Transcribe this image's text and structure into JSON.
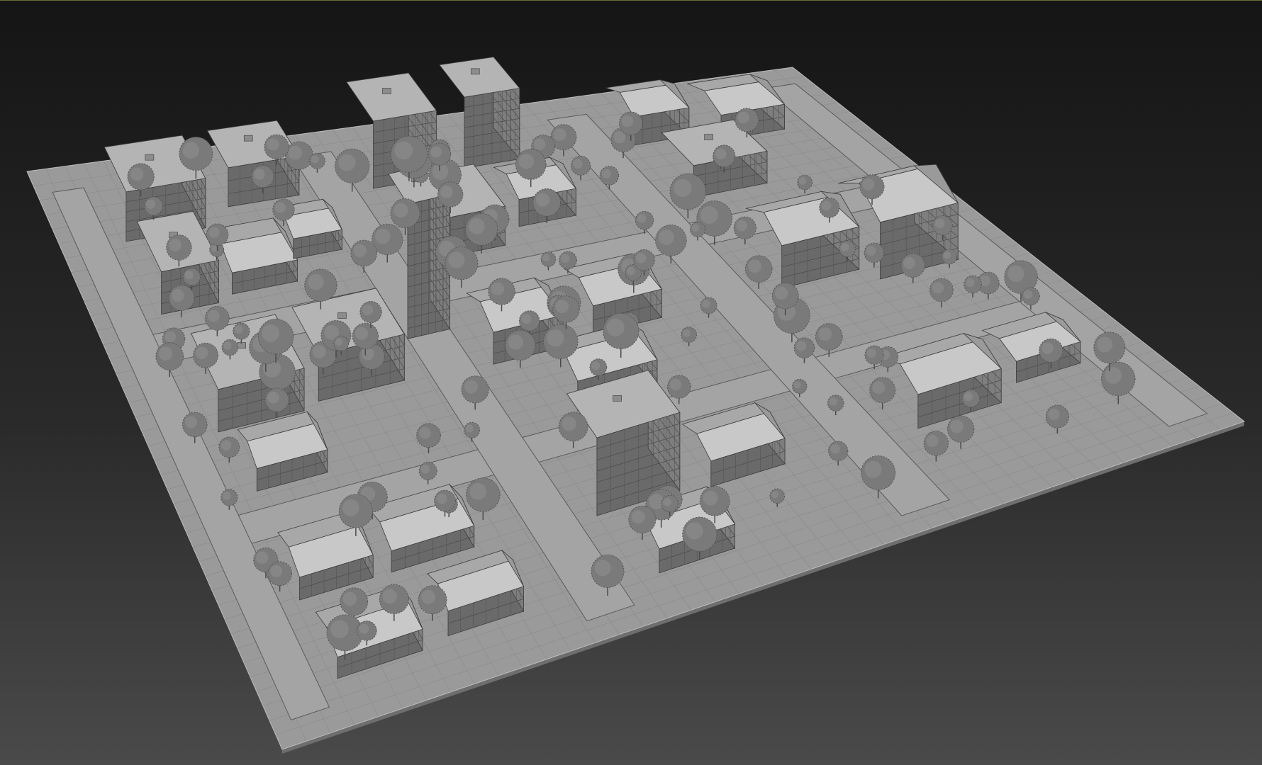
{
  "scene": {
    "type": "3d-viewport",
    "subject": "city-block-model",
    "render_style": "shaded-grey-with-edged-faces",
    "colors": {
      "background_top": "#151515",
      "background_bottom": "#4a4a4a",
      "ground": "#9a9a9a",
      "ground_shadow": "#6e6e6e",
      "road_line": "#5a5a5a",
      "building_top": "#b4b4b4",
      "building_side": "#6a6a6a",
      "tree": "#7a7a7a",
      "tree_dark": "#555555"
    }
  }
}
